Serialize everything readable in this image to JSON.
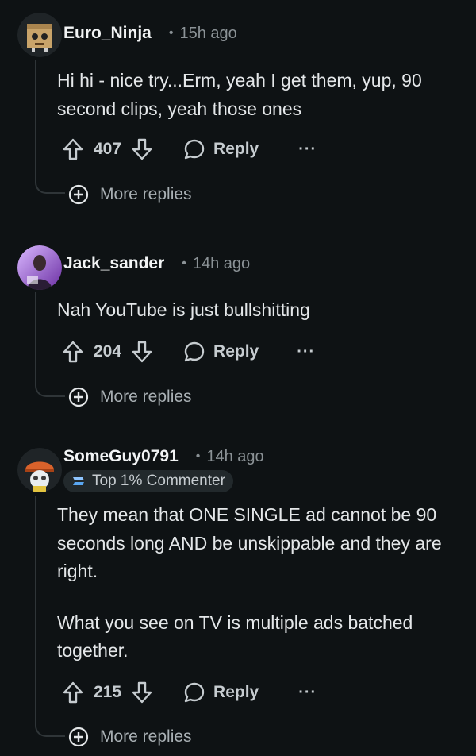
{
  "comments": [
    {
      "username": "Euro_Ninja",
      "time": "15h ago",
      "avatar": "box-robot-avatar",
      "body": [
        "Hi hi - nice try...Erm, yeah I get them, yup, 90 second clips, yeah those ones"
      ],
      "votes": "407",
      "reply_label": "Reply",
      "more_label": "···",
      "more_replies_label": "More replies"
    },
    {
      "username": "Jack_sander",
      "time": "14h ago",
      "avatar": "photo-avatar",
      "body": [
        "Nah YouTube is just bullshitting"
      ],
      "votes": "204",
      "reply_label": "Reply",
      "more_label": "···",
      "more_replies_label": "More replies"
    },
    {
      "username": "SomeGuy0791",
      "time": "14h ago",
      "avatar": "helmet-avatar",
      "flair": "Top 1% Commenter",
      "body": [
        "They mean that ONE SINGLE ad cannot be 90 seconds long AND be unskippable and they are right.",
        "What you see on TV is multiple ads batched together."
      ],
      "votes": "215",
      "reply_label": "Reply",
      "more_label": "···",
      "more_replies_label": "More replies"
    }
  ],
  "colors": {
    "background": "#0e1214",
    "text": "#e4e7e9",
    "muted": "#8b9296",
    "thread": "#2f3538"
  }
}
